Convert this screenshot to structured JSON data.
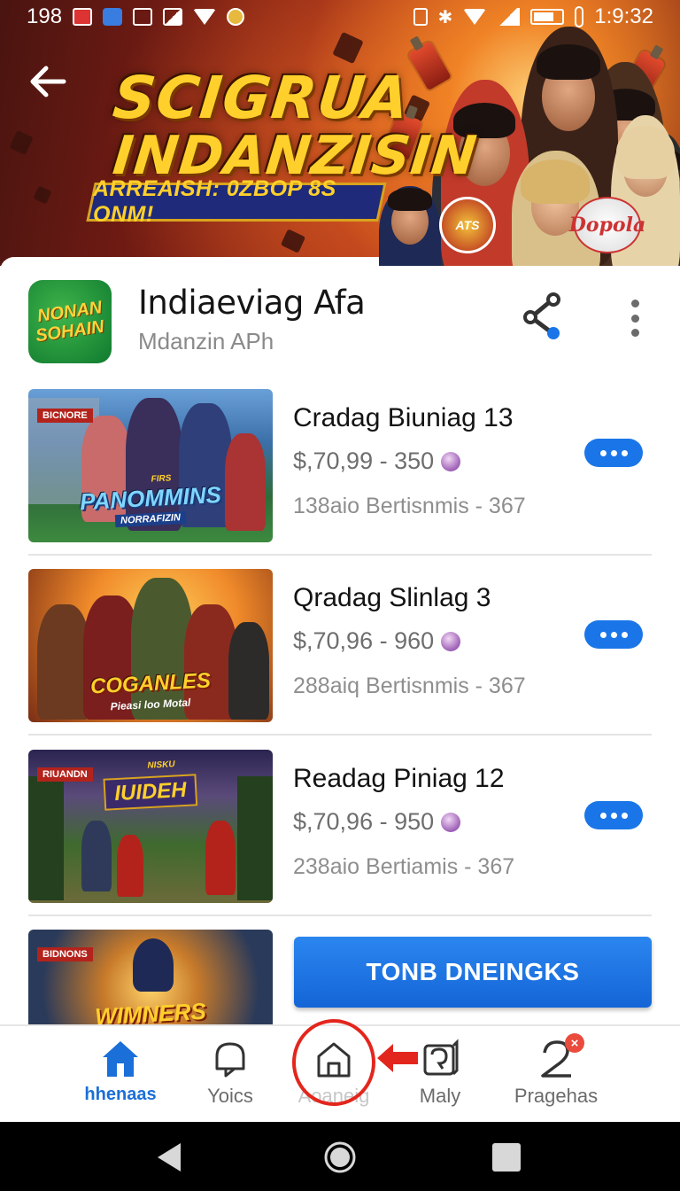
{
  "status_bar": {
    "left_text": "198",
    "time": "1:9:32",
    "icons": [
      "notification-red-icon",
      "notification-blue-icon",
      "photo-icon",
      "image-icon",
      "wifi-icon",
      "coin-icon",
      "vibrate-icon",
      "bluetooth-icon",
      "wifi-icon",
      "signal-icon",
      "battery-icon",
      "thermometer-icon"
    ]
  },
  "hero": {
    "title_line1": "SCIGRUA",
    "title_line2": "INDANZISIN",
    "banner": "ARREAISH: 0ZBOP 8S ONM!",
    "badge_left": "ATS",
    "badge_right": "Dopola",
    "colors": {
      "title": "#ffd02b",
      "banner_bg": "#1f2a7a"
    }
  },
  "app": {
    "icon_text_1": "NONAN",
    "icon_text_2": "SOHAIN",
    "name": "Indiaeviag Afa",
    "subtitle": "Mdanzin APh"
  },
  "items": [
    {
      "title": "Cradag Biuniag 13",
      "price": "$,70,99 - 350",
      "meta": "138aio  Bertisnmis - 367",
      "thumb_logo": "PANOMMINS",
      "thumb_sub": "NORRAFIZIN",
      "thumb_tag": "BICNORE",
      "thumb_small": "FIRS"
    },
    {
      "title": "Qradag Slinlag 3",
      "price": "$,70,96 - 960",
      "meta": "288aiq  Bertisnmis - 367",
      "thumb_logo": "COGANLES",
      "thumb_sub": "Pieasi loo Motal"
    },
    {
      "title": "Readag Piniag 12",
      "price": "$,70,96 - 950",
      "meta": "238aio  Bertiamis - 367",
      "thumb_logo": "IUIDEH",
      "thumb_tag": "RIUANDN",
      "thumb_small": "NISKU"
    },
    {
      "thumb_logo": "WIMNERS",
      "thumb_tag": "BIDNONS"
    }
  ],
  "cta_label": "TONB DNEINGKS",
  "bottom_nav": [
    {
      "label": "hhenaas",
      "icon": "home-icon",
      "active": true
    },
    {
      "label": "Yoics",
      "icon": "bell-icon",
      "active": false
    },
    {
      "label": "Aoaneig",
      "icon": "home-outline-icon",
      "active": false,
      "highlighted": true
    },
    {
      "label": "Maly",
      "icon": "message-icon",
      "active": false
    },
    {
      "label": "Pragehas",
      "icon": "number-two-icon",
      "active": false,
      "badge": "×"
    }
  ],
  "accent_color": "#1a76e8"
}
